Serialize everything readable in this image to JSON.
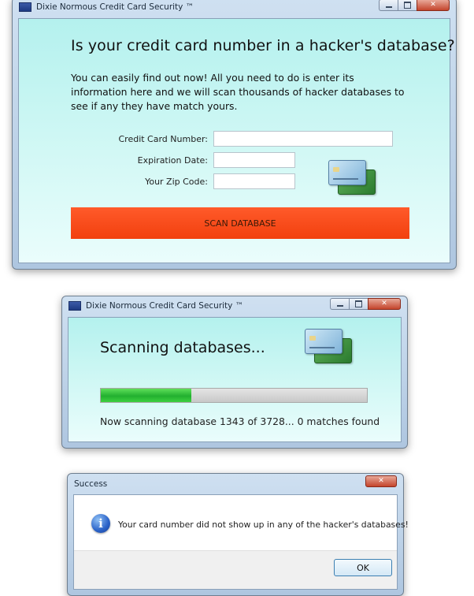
{
  "windows": {
    "main": {
      "title": "Dixie Normous Credit Card Security ™",
      "headline": "Is your credit card number in a hacker's database?",
      "intro": "You can easily find out now! All you need to do is enter its information here and we will scan thousands of hacker databases to see if any they have match yours.",
      "fields": {
        "card_number_label": "Credit Card Number:",
        "card_number_value": "",
        "expiration_label": "Expiration Date:",
        "expiration_value": "",
        "zip_label": "Your Zip Code:",
        "zip_value": ""
      },
      "scan_button": "SCAN DATABASE",
      "icons": [
        "app-icon",
        "credit-cards-icon",
        "minimize-icon",
        "maximize-icon",
        "close-icon"
      ]
    },
    "scanning": {
      "title": "Dixie Normous Credit Card Security ™",
      "heading": "Scanning databases...",
      "progress_percent": 34,
      "status": "Now scanning database 1343 of 3728... 0 matches found",
      "icons": [
        "app-icon",
        "credit-cards-icon",
        "minimize-icon",
        "maximize-icon",
        "close-icon"
      ]
    },
    "dialog": {
      "title": "Success",
      "message": "Your card number did not show up in any of the hacker's databases!",
      "ok_button": "OK",
      "icons": [
        "info-icon",
        "close-icon"
      ]
    }
  },
  "colors": {
    "scan_button": "#f2400e",
    "progress_fill": "#22b030",
    "client_background": "#b4f1ee"
  }
}
